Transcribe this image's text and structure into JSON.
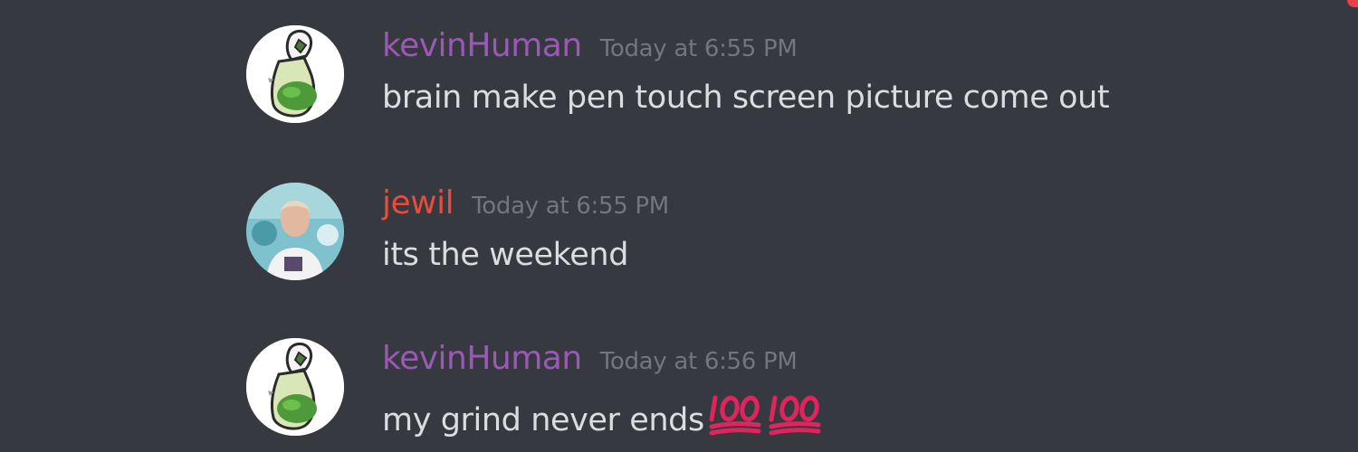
{
  "colors": {
    "background": "#36393f",
    "message_text": "#dcddde",
    "timestamp": "#72767d",
    "emoji_red": "#e0245e"
  },
  "messages": [
    {
      "username": "kevinHuman",
      "username_color": "#9b59b6",
      "timestamp": "Today at 6:55 PM",
      "text": "brain make pen touch screen picture come out",
      "avatar_icon": "potion-bottle-icon"
    },
    {
      "username": "jewil",
      "username_color": "#e74c3c",
      "timestamp": "Today at 6:55 PM",
      "text": "its the weekend",
      "avatar_icon": "person-photo-avatar"
    },
    {
      "username": "kevinHuman",
      "username_color": "#9b59b6",
      "timestamp": "Today at 6:56 PM",
      "text": "my grind never ends",
      "avatar_icon": "potion-bottle-icon",
      "emojis": [
        "hundred-points-icon",
        "hundred-points-icon"
      ]
    }
  ]
}
